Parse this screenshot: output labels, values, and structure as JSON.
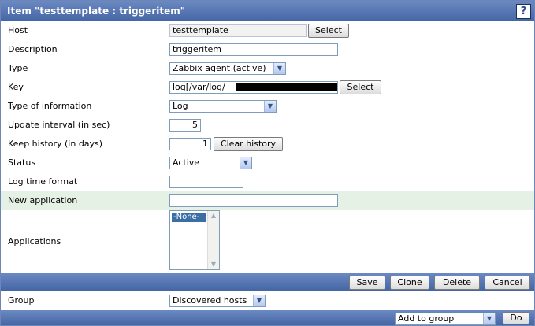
{
  "title": "Item \"testtemplate : triggeritem\"",
  "help_glyph": "?",
  "fields": {
    "host": {
      "label": "Host",
      "value": "testtemplate",
      "button": "Select"
    },
    "description": {
      "label": "Description",
      "value": "triggeritem"
    },
    "type": {
      "label": "Type",
      "value": "Zabbix agent (active)"
    },
    "key": {
      "label": "Key",
      "value": "log[/var/log/",
      "button": "Select"
    },
    "type_of_information": {
      "label": "Type of information",
      "value": "Log"
    },
    "update_interval": {
      "label": "Update interval (in sec)",
      "value": "5"
    },
    "keep_history": {
      "label": "Keep history (in days)",
      "value": "1",
      "button": "Clear history"
    },
    "status": {
      "label": "Status",
      "value": "Active"
    },
    "log_time_format": {
      "label": "Log time format",
      "value": ""
    },
    "new_application": {
      "label": "New application",
      "value": ""
    },
    "applications": {
      "label": "Applications",
      "options": [
        "-None-"
      ]
    }
  },
  "actions": {
    "save": "Save",
    "clone": "Clone",
    "delete": "Delete",
    "cancel": "Cancel"
  },
  "group": {
    "label": "Group",
    "value": "Discovered hosts"
  },
  "footer": {
    "action": "Add to group",
    "do": "Do"
  },
  "colors": {
    "header": "#4f6fae",
    "highlight_row": "#e6f1e6",
    "selected_option": "#3a6ea5"
  }
}
